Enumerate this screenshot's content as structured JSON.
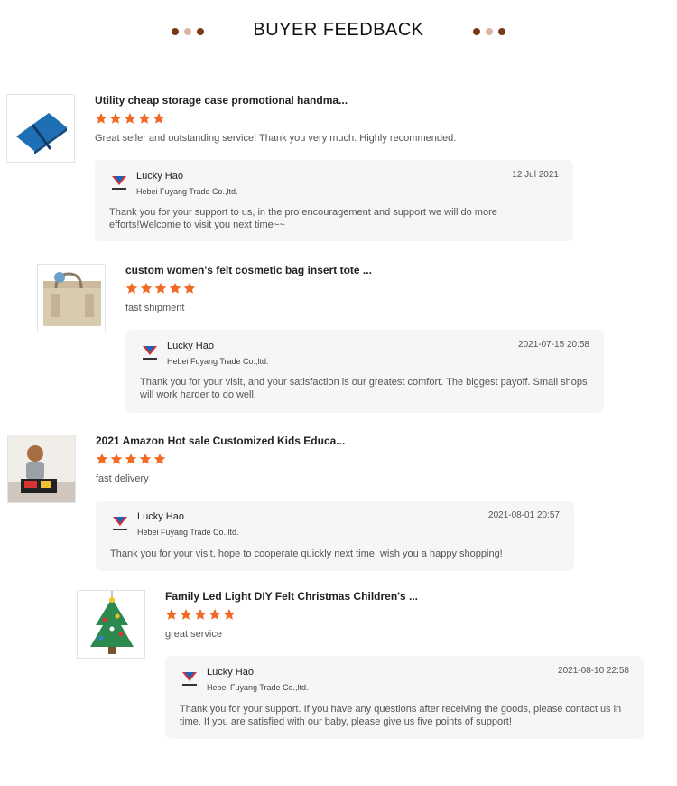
{
  "header": {
    "title": "BUYER FEEDBACK"
  },
  "colors": {
    "star": "#f06a23",
    "dot_dark": "#7a3a16",
    "dot_light": "#d9b4a4",
    "reply_bg": "#f5f6f8"
  },
  "reviews": [
    {
      "product_title": "Utility cheap storage case promotional handma...",
      "rating": 5,
      "comment": "Great seller and outstanding service! Thank you very much. Highly recommended.",
      "reply": {
        "seller_name": "Lucky Hao",
        "company": "Hebei Fuyang Trade Co.,ltd.",
        "date": "12 Jul 2021",
        "text": "Thank you for your support to us, in the pro encouragement and support we will do more efforts!Welcome to visit you next time~~"
      }
    },
    {
      "product_title": "custom women's felt cosmetic bag insert tote ...",
      "rating": 5,
      "comment": "fast shipment",
      "reply": {
        "seller_name": "Lucky Hao",
        "company": "Hebei Fuyang Trade Co.,ltd.",
        "date": "2021-07-15 20:58",
        "text": "Thank you for your visit, and your satisfaction is our greatest comfort.  The biggest payoff.  Small shops will work harder to do well."
      }
    },
    {
      "product_title": "2021 Amazon Hot sale Customized Kids Educa...",
      "rating": 5,
      "comment": "fast delivery",
      "reply": {
        "seller_name": "Lucky Hao",
        "company": "Hebei Fuyang Trade Co.,ltd.",
        "date": "2021-08-01 20:57",
        "text": "Thank you for your visit, hope to cooperate quickly next time, wish you a happy shopping!"
      }
    },
    {
      "product_title": "Family Led Light DIY Felt Christmas Children's ...",
      "rating": 5,
      "comment": "great service",
      "reply": {
        "seller_name": "Lucky Hao",
        "company": "Hebei Fuyang Trade Co.,ltd.",
        "date": "2021-08-10 22:58",
        "text": "Thank you for your support. If you have any questions after receiving the goods, please contact us in time. If you are satisfied with our baby, please give us five points of support!"
      }
    }
  ]
}
